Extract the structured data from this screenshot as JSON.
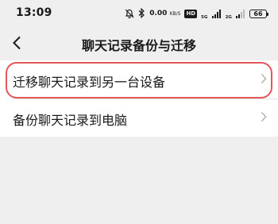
{
  "status_bar": {
    "time": "13:09",
    "net_speed_value": "0.00",
    "net_speed_unit": "KB/S",
    "hd_label": "HD",
    "signal_1_label": "5G",
    "signal_2_label": "2G",
    "battery": "66"
  },
  "nav": {
    "title": "聊天记录备份与迁移",
    "back_icon": "chevron-left-icon"
  },
  "list": {
    "items": [
      {
        "label": "迁移聊天记录到另一台设备",
        "highlighted": true
      },
      {
        "label": "备份聊天记录到电脑",
        "highlighted": false
      }
    ]
  },
  "colors": {
    "background": "#efefef",
    "card": "#ffffff",
    "highlight": "#e2575a",
    "chevron": "#b3b3b3"
  }
}
